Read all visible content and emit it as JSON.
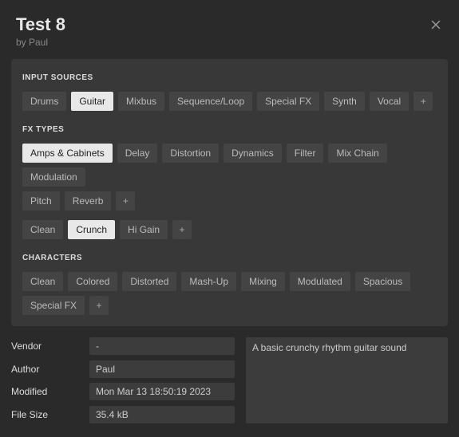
{
  "header": {
    "title": "Test 8",
    "byline": "by Paul"
  },
  "sections": {
    "inputSources": {
      "label": "INPUT SOURCES",
      "tags": [
        "Drums",
        "Guitar",
        "Mixbus",
        "Sequence/Loop",
        "Special FX",
        "Synth",
        "Vocal"
      ],
      "active": [
        "Guitar"
      ]
    },
    "fxTypes": {
      "label": "FX TYPES",
      "row1": [
        "Amps & Cabinets",
        "Delay",
        "Distortion",
        "Dynamics",
        "Filter",
        "Mix Chain",
        "Modulation"
      ],
      "row2": [
        "Pitch",
        "Reverb"
      ],
      "row3": [
        "Clean",
        "Crunch",
        "Hi Gain"
      ],
      "active": [
        "Amps & Cabinets",
        "Crunch"
      ]
    },
    "characters": {
      "label": "CHARACTERS",
      "row1": [
        "Clean",
        "Colored",
        "Distorted",
        "Mash-Up",
        "Mixing",
        "Modulated",
        "Spacious"
      ],
      "row2": [
        "Special FX"
      ],
      "active": []
    }
  },
  "meta": {
    "vendorLabel": "Vendor",
    "vendorValue": "-",
    "authorLabel": "Author",
    "authorValue": "Paul",
    "modifiedLabel": "Modified",
    "modifiedValue": "Mon Mar 13 18:50:19 2023",
    "fileSizeLabel": "File Size",
    "fileSizeValue": "35.4 kB",
    "description": "A basic crunchy rhythm guitar sound"
  },
  "addGlyph": "+"
}
